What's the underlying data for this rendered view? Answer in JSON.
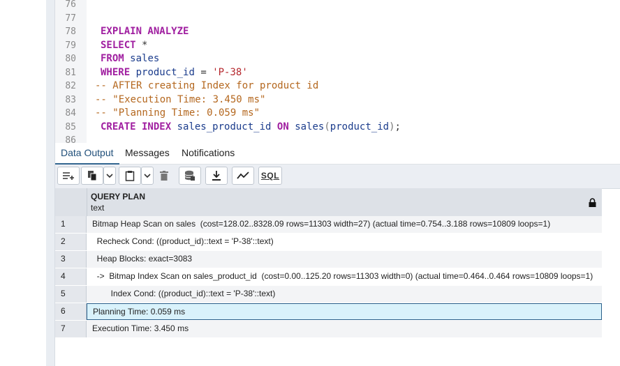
{
  "editor": {
    "lines": [
      {
        "num": "76",
        "html": ""
      },
      {
        "num": "77",
        "html": ""
      },
      {
        "num": "78",
        "html": "<span class='kw'>EXPLAIN ANALYZE</span>"
      },
      {
        "num": "79",
        "html": "<span class='kw'>SELECT</span> <span class='op'>*</span>"
      },
      {
        "num": "80",
        "html": "<span class='kw'>FROM</span> <span class='plain'>sales</span>"
      },
      {
        "num": "81",
        "html": "<span class='kw'>WHERE</span> <span class='plain'>product_id</span> <span class='op'>=</span> <span class='str'>'P-38'</span>"
      },
      {
        "num": "82",
        "html": "<span class='cm'>-- AFTER creating Index for product id</span>"
      },
      {
        "num": "83",
        "html": "<span class='cm'>-- \"Execution Time: 3.450 ms\"</span>"
      },
      {
        "num": "84",
        "html": "<span class='cm'>-- \"Planning Time: 0.059 ms\"</span>"
      },
      {
        "num": "85",
        "html": "<span class='kw'>CREATE INDEX</span> <span class='plain'>sales_product_id</span> <span class='kw'>ON</span> <span class='plain'>sales</span><span class='par'>(</span><span class='plain'>product_id</span><span class='par'>)</span><span class='op'>;</span>"
      },
      {
        "num": "86",
        "html": ""
      }
    ],
    "code_indent": [
      1,
      1,
      1,
      1,
      1,
      1,
      0,
      0,
      0,
      1,
      0
    ]
  },
  "tabs": {
    "data_output": "Data Output",
    "messages": "Messages",
    "notifications": "Notifications"
  },
  "toolbar": {
    "sql_label": "SQL"
  },
  "grid": {
    "column_name": "QUERY PLAN",
    "column_type": "text",
    "rows": [
      {
        "n": "1",
        "text": "Bitmap Heap Scan on sales  (cost=128.02..8328.09 rows=11303 width=27) (actual time=0.754..3.188 rows=10809 loops=1)"
      },
      {
        "n": "2",
        "text": "  Recheck Cond: ((product_id)::text = 'P-38'::text)"
      },
      {
        "n": "3",
        "text": "  Heap Blocks: exact=3083"
      },
      {
        "n": "4",
        "text": "  ->  Bitmap Index Scan on sales_product_id  (cost=0.00..125.20 rows=11303 width=0) (actual time=0.464..0.464 rows=10809 loops=1)"
      },
      {
        "n": "5",
        "text": "        Index Cond: ((product_id)::text = 'P-38'::text)"
      },
      {
        "n": "6",
        "text": "Planning Time: 0.059 ms"
      },
      {
        "n": "7",
        "text": "Execution Time: 3.450 ms"
      }
    ],
    "selected_row": 5
  }
}
